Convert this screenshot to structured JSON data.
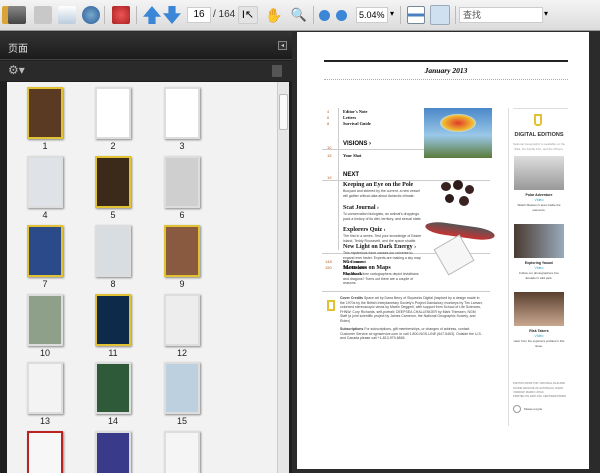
{
  "toolbar": {
    "page_current": "16",
    "page_total": "/ 164",
    "zoom": "5.04%",
    "search_placeholder": "查找"
  },
  "left_panel": {
    "title": "页面",
    "thumbnails": [
      {
        "label": "1",
        "color": "#5a3a22",
        "border": "#e1c233"
      },
      {
        "label": "2",
        "color": "#ffffff",
        "border": "#ddd"
      },
      {
        "label": "3",
        "color": "#ffffff",
        "border": "#ddd"
      },
      {
        "label": "4",
        "color": "#dfe3e8",
        "border": "#ddd"
      },
      {
        "label": "5",
        "color": "#3b2a1a",
        "border": "#e1c233"
      },
      {
        "label": "6",
        "color": "#cfcfcf",
        "border": "#ddd"
      },
      {
        "label": "7",
        "color": "#2b4a8a",
        "border": "#e1c233"
      },
      {
        "label": "8",
        "color": "#d8dde2",
        "border": "#ddd"
      },
      {
        "label": "9",
        "color": "#8a5a40",
        "border": "#e1c233"
      },
      {
        "label": "10",
        "color": "#8fa08a",
        "border": "#ddd"
      },
      {
        "label": "11",
        "color": "#0e2a4a",
        "border": "#e1c233"
      },
      {
        "label": "12",
        "color": "#ededed",
        "border": "#ddd"
      },
      {
        "label": "13",
        "color": "#f3f3f3",
        "border": "#ddd"
      },
      {
        "label": "14",
        "color": "#2f5a3a",
        "border": "#ddd"
      },
      {
        "label": "15",
        "color": "#bcd0e0",
        "border": "#ddd"
      },
      {
        "label": "",
        "color": "#f7f7f7",
        "border": "#b22"
      },
      {
        "label": "",
        "color": "#3a3a8a",
        "border": "#ddd"
      },
      {
        "label": "",
        "color": "#f5f5f5",
        "border": "#ddd"
      }
    ]
  },
  "doc": {
    "date": "January 2013",
    "toc_top": [
      {
        "num": "4",
        "title": "Editor's Note"
      },
      {
        "num": "6",
        "title": "Letters"
      },
      {
        "num": "8",
        "title": "Survival Guide"
      }
    ],
    "visions": {
      "num": "10",
      "title": "VISIONS ›"
    },
    "your_shot": {
      "num": "15",
      "title": "Your Shot"
    },
    "next": {
      "num": "19",
      "title": "NEXT"
    },
    "articles": [
      {
        "title": "Keeping an Eye on the Pole",
        "desc": "Buoyant and steered by the current, a new vessel will gather critical data about Antarctic climate."
      },
      {
        "title": "Scat Journal ›",
        "desc": "To conservation biologists, an animal's droppings pack a history of its diet, territory, and sexual state."
      },
      {
        "title": "Explorers Quiz ›",
        "desc": "The first in a series. Test your knowledge of Easter Island, Teddy Roosevelt, and the space shuttle."
      },
      {
        "title": "New Light on Dark Energy ›",
        "desc": "This mysterious force causes our universe to expand ever faster. Experts are making a sky map to learn more."
      },
      {
        "title": "Monsters on Maps",
        "desc": "Why did old-time cartographers depict leviathans and dragons? Turns out there are a couple of reasons."
      }
    ],
    "toc_bottom": [
      {
        "num": "148",
        "title": "NG Connect"
      },
      {
        "num": "150",
        "title": "The Moment"
      },
      {
        "num": "",
        "title": "Flashback"
      }
    ],
    "cover_credits_label": "Cover Credits",
    "cover_credits": "Space art by Dana Berry of Skyworks Digital (inspired by a design made in the 1970s by the British Interplanetary Society's Project Daedalus); monkeys by Tim Laman; colorized stereoscopic views by Martin Oeggerli, with support from School of Life Sciences, FHNW; Cory Richards, self-portrait; DEEPSEA CHALLENGER by Mark Thiessen, NGM Staff (a joint scientific project by James Cameron, the National Geographic Society, and Rolex)",
    "subscriptions_label": "Subscriptions",
    "subscriptions": "For subscriptions, gift memberships, or changes of address, contact Customer Service at ngmservice.com or call 1-800-NGS-LINE (647-5463). Outside the U.S. and Canada please call +1-813-979-6845.",
    "sidebar": {
      "title": "DIGITAL EDITIONS",
      "intro": "National Geographic is available on the iPad, the Kindle Fire, and the iPhone.",
      "items": [
        {
          "title": "Polar Adventure",
          "type": "Video",
          "desc": "Watch Mawson's team battle the elements."
        },
        {
          "title": "Exploring Yasuni",
          "type": "Video",
          "desc": "Follow our photographers into Ecuador's wild park."
        },
        {
          "title": "Risk Takers",
          "type": "Video",
          "desc": "Hear from the explorers profiled in this issue."
        }
      ],
      "footer1": "PHOTOS FROM TOP: NATIONAL FILM AND SOUND ARCHIVE OF AUSTRALIA; DAVID YARROW; MARKO JOVIC",
      "footer2": "PRINTED ON 100% FSC CERTIFIED PAPER",
      "recycle": "Please recycle"
    }
  }
}
